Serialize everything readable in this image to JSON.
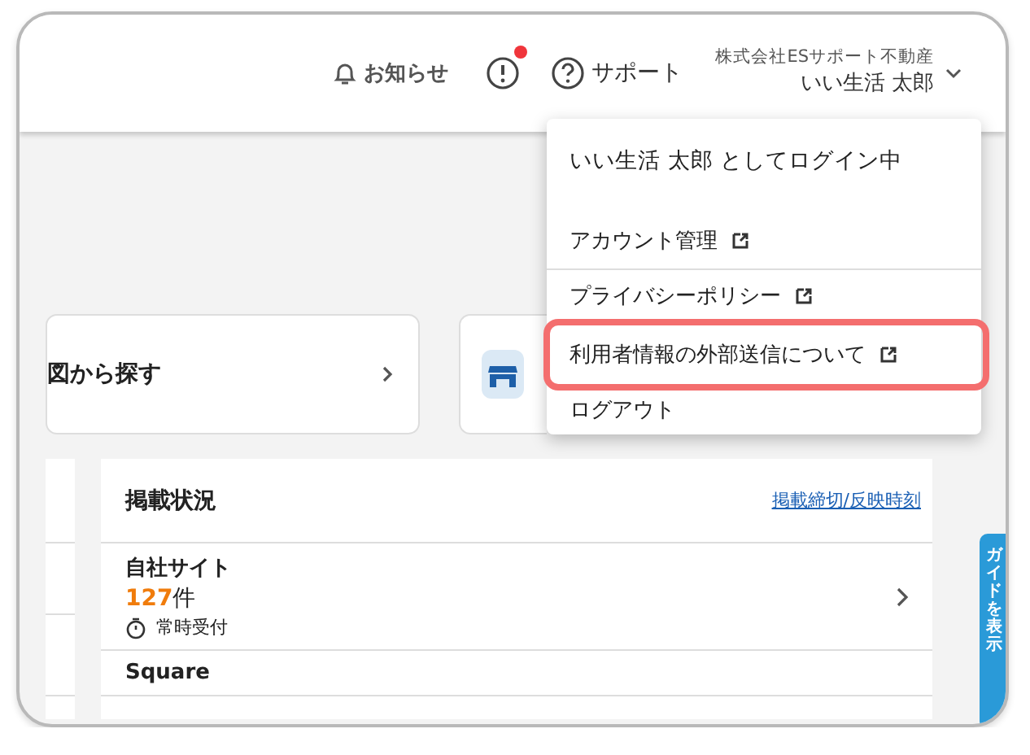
{
  "header": {
    "notice_label": "お知らせ",
    "has_alert": true,
    "support_label": "サポート",
    "company": "株式会社ESサポート不動産",
    "user": "いい生活 太郎"
  },
  "search_card": {
    "label": "図から探す"
  },
  "listing": {
    "title": "掲載状況",
    "link": "掲載締切/反映時刻",
    "rows": [
      {
        "name": "自社サイト",
        "count": "127",
        "unit": "件",
        "status": "常時受付"
      },
      {
        "name": "Square"
      }
    ]
  },
  "guide_tab": {
    "label": "ガイドを表示"
  },
  "user_menu": {
    "heading": "いい生活 太郎 としてログイン中",
    "items": [
      {
        "label": "アカウント管理",
        "external": true,
        "highlighted": false
      },
      {
        "label": "プライバシーポリシー",
        "external": true,
        "highlighted": false
      },
      {
        "label": "利用者情報の外部送信について",
        "external": true,
        "highlighted": true
      },
      {
        "label": "ログアウト",
        "external": false,
        "highlighted": false
      }
    ]
  }
}
